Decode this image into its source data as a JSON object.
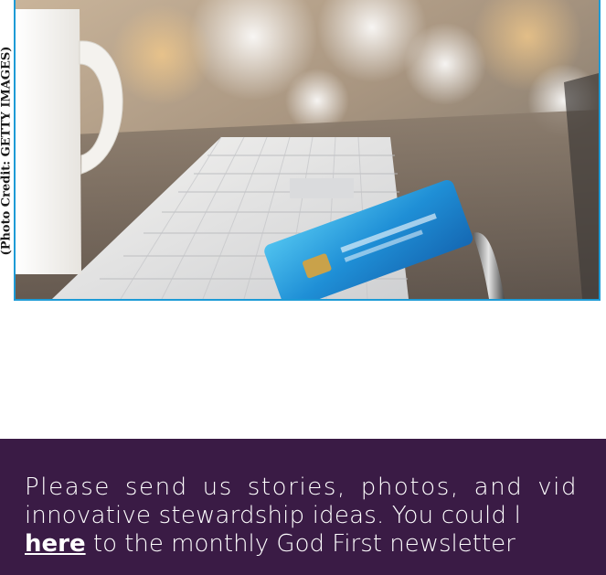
{
  "photo": {
    "credit": "(Photo Credit: GETTY IMAGES)",
    "subject": "keyboard-coffee-mug-credit-card-photo"
  },
  "banner": {
    "line1": "Please send us stories, photos, and vid",
    "line2": "innovative stewardship ideas. You could l",
    "link_label": "here",
    "line3_rest": " to the monthly God First newsletter"
  },
  "colors": {
    "banner_bg": "#3a1b45",
    "photo_border": "#1d9bd6",
    "text": "#ffffff"
  }
}
